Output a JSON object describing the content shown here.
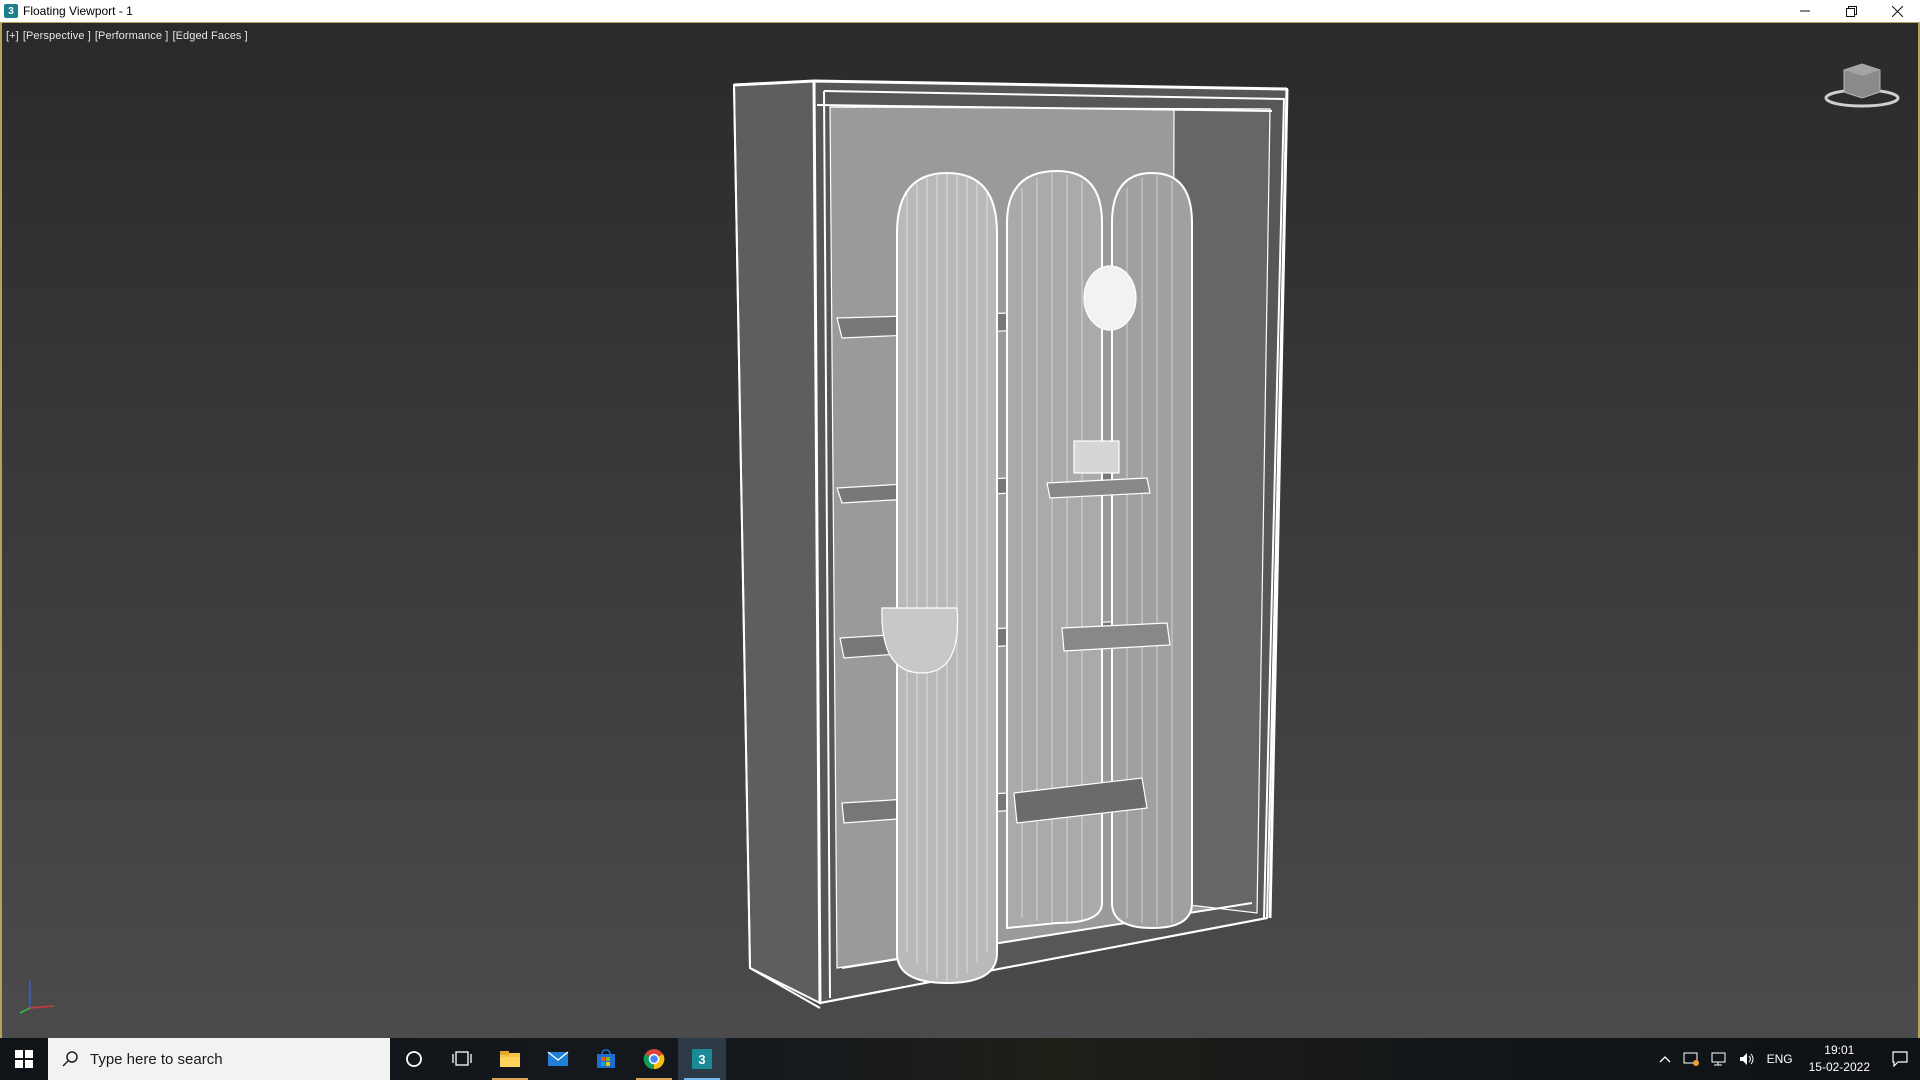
{
  "window": {
    "title": "Floating Viewport - 1",
    "icon": "3dsmax-app-icon",
    "controls": [
      "minimize-icon",
      "restore-icon",
      "close-icon"
    ]
  },
  "viewport": {
    "label": {
      "menu": "[+]",
      "view": "[Perspective ]",
      "shading_mode": "[Performance ]",
      "display": "[Edged Faces ]"
    },
    "background_top": "#2a2a2a",
    "background_bottom": "#4b4b4b",
    "border_color": "#b8a15a",
    "wire_color": "#ffffff"
  },
  "taskbar": {
    "search_placeholder": "Type here to search",
    "apps": [
      "cortana-icon",
      "task-view-icon",
      "file-explorer-icon",
      "mail-icon",
      "microsoft-store-icon",
      "chrome-icon",
      "3dsmax-icon"
    ],
    "tray": {
      "language": "ENG",
      "time": "19:01",
      "date": "15-02-2022"
    }
  }
}
